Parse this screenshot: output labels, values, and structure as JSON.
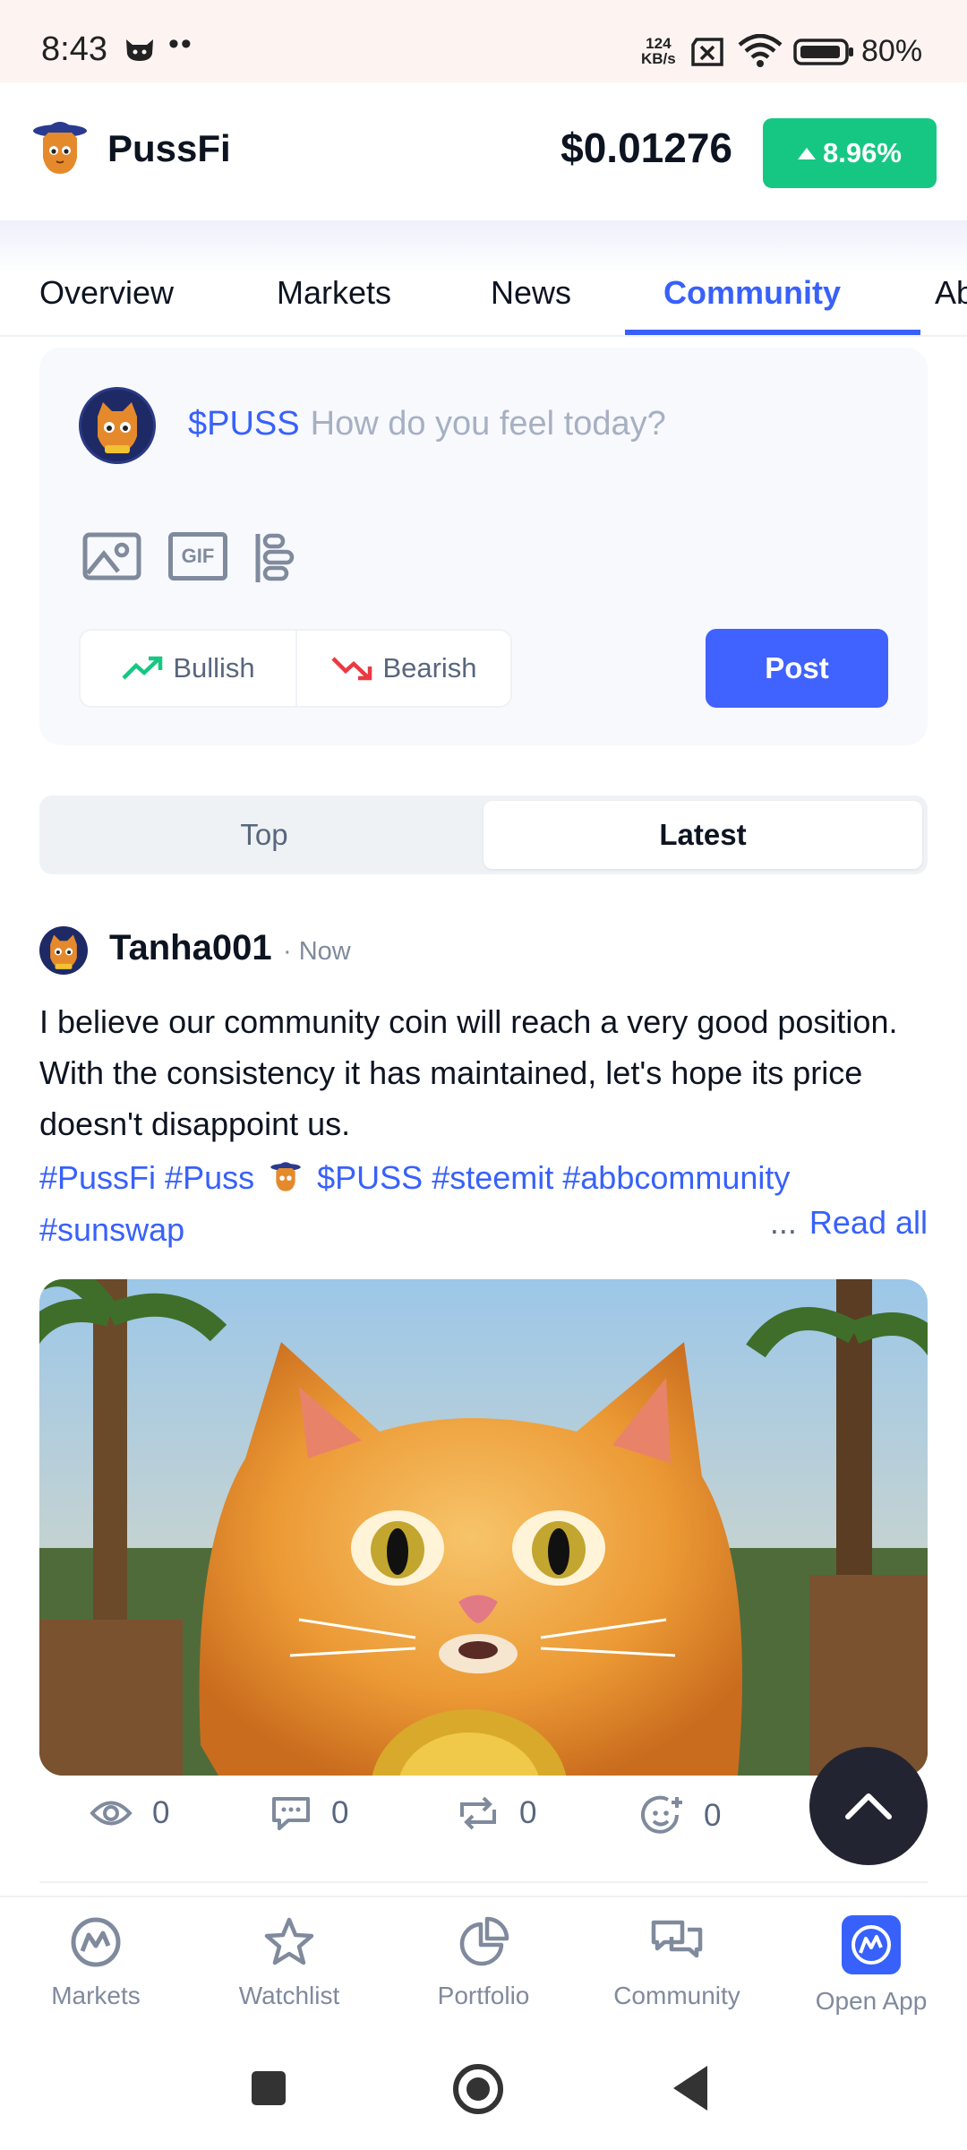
{
  "status_bar": {
    "time": "8:43",
    "dots": "••",
    "speed_value": "124",
    "speed_unit": "KB/s",
    "battery": "80%"
  },
  "header": {
    "brand": "PussFi",
    "price": "$0.01276",
    "change": "8.96%",
    "change_color": "#16c784"
  },
  "tabs": [
    {
      "label": "Overview",
      "active": false
    },
    {
      "label": "Markets",
      "active": false
    },
    {
      "label": "News",
      "active": false
    },
    {
      "label": "Community",
      "active": true
    },
    {
      "label": "Ab",
      "active": false
    }
  ],
  "composer": {
    "ticker": "$PUSS",
    "placeholder": "How do you feel today?",
    "tools": [
      "image-icon",
      "gif-icon",
      "poll-icon"
    ],
    "gif_label": "GIF",
    "bullish_label": "Bullish",
    "bearish_label": "Bearish",
    "post_label": "Post",
    "accent": "#4062ff"
  },
  "feed_toggle": {
    "options": [
      "Top",
      "Latest"
    ],
    "selected": "Latest"
  },
  "post": {
    "username": "Tanha001",
    "time": "· Now",
    "body": "I believe our community coin will reach a very good position. With the consistency it has maintained, let's hope its price doesn't disappoint us.",
    "tags_line1_a": "#PussFi #Puss",
    "tags_line1_b": "$PUSS #steemit #abbcommunity",
    "tags_line2": "#sunswap",
    "ellipsis": "...",
    "read_all": "Read all",
    "stats": {
      "views": "0",
      "comments": "0",
      "reposts": "0",
      "reactions": "0"
    },
    "more": "•••"
  },
  "bottom_nav": [
    {
      "label": "Markets",
      "icon": "markets-icon"
    },
    {
      "label": "Watchlist",
      "icon": "star-icon"
    },
    {
      "label": "Portfolio",
      "icon": "pie-chart-icon"
    },
    {
      "label": "Community",
      "icon": "chat-icon"
    },
    {
      "label": "Open App",
      "icon": "app-logo-icon"
    }
  ]
}
